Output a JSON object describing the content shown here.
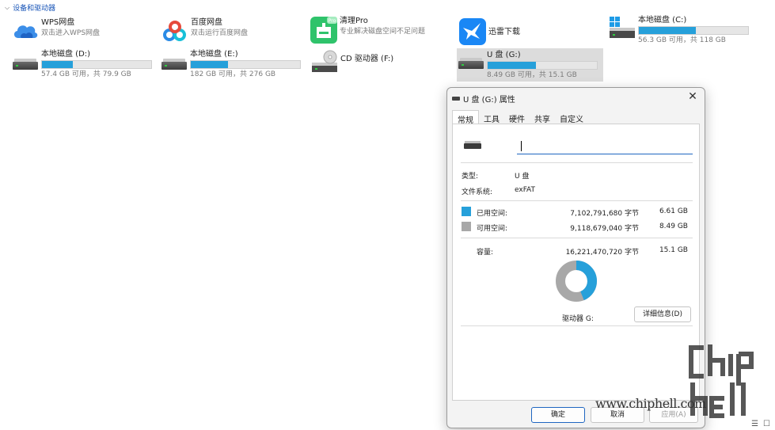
{
  "section": {
    "title": "设备和驱动器"
  },
  "items": {
    "wps": {
      "name": "WPS网盘",
      "sub": "双击进入WPS网盘"
    },
    "baidu": {
      "name": "百度网盘",
      "sub": "双击运行百度网盘"
    },
    "qingli": {
      "name": "清理Pro",
      "sub": "专业解决磁盘空间不足问题",
      "badge": "Pro"
    },
    "xunlei": {
      "name": "迅雷下载"
    },
    "c": {
      "name": "本地磁盘 (C:)",
      "sub": "56.3 GB 可用，共 118 GB",
      "used_fraction": 0.52
    },
    "d": {
      "name": "本地磁盘 (D:)",
      "sub": "57.4 GB 可用，共 79.9 GB",
      "used_fraction": 0.28
    },
    "e": {
      "name": "本地磁盘 (E:)",
      "sub": "182 GB 可用，共 276 GB",
      "used_fraction": 0.34
    },
    "f": {
      "name": "CD 驱动器 (F:)"
    },
    "g": {
      "name": "U 盘 (G:)",
      "sub": "8.49 GB 可用，共 15.1 GB",
      "used_fraction": 0.44
    }
  },
  "dialog": {
    "title": "U 盘 (G:) 属性",
    "close": "✕",
    "tabs": [
      "常规",
      "工具",
      "硬件",
      "共享",
      "自定义"
    ],
    "active_tab": 0,
    "name_value": "",
    "type_label": "类型:",
    "type_value": "U 盘",
    "fs_label": "文件系统:",
    "fs_value": "exFAT",
    "used_label": "已用空间:",
    "used_bytes": "7,102,791,680 字节",
    "used_gb": "6.61 GB",
    "free_label": "可用空间:",
    "free_bytes": "9,118,679,040 字节",
    "free_gb": "8.49 GB",
    "cap_label": "容量:",
    "cap_bytes": "16,221,470,720 字节",
    "cap_gb": "15.1 GB",
    "drive_label": "驱动器 G:",
    "details_button": "详细信息(D)",
    "ok_button": "确定",
    "cancel_button": "取消",
    "apply_button": "应用(A)",
    "used_fraction": 0.438
  },
  "colors": {
    "accent": "#26a0da",
    "used": "#26a0da",
    "free": "#a8a8a8",
    "link": "#1a56b8"
  },
  "watermark": {
    "site": "www.chiphell.com",
    "logo_text": "chip hell"
  }
}
